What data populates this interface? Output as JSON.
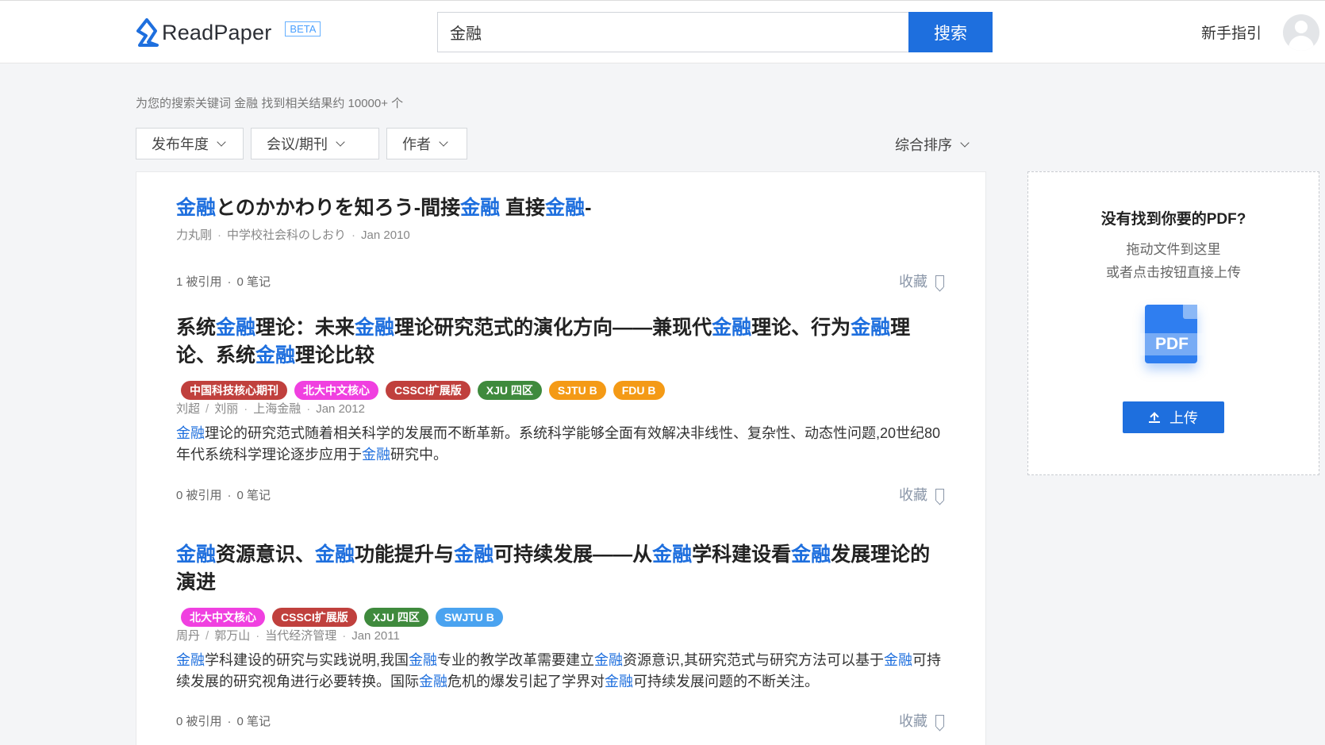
{
  "header": {
    "logo_text": "ReadPaper",
    "beta_label": "BETA",
    "search_value": "金融",
    "search_button": "搜索",
    "guide_link": "新手指引"
  },
  "summary": "为您的搜索关键词 金融 找到相关结果约 10000+ 个",
  "filters": [
    {
      "label": "发布年度"
    },
    {
      "label": "会议/期刊"
    },
    {
      "label": "作者"
    }
  ],
  "sort_label": "综合排序",
  "results": [
    {
      "title": [
        {
          "t": "金融",
          "hl": true
        },
        {
          "t": "とのかかわりを知ろう-間接"
        },
        {
          "t": "金融",
          "hl": true
        },
        {
          "t": " 直接"
        },
        {
          "t": "金融",
          "hl": true
        },
        {
          "t": "-"
        }
      ],
      "authors": [
        "力丸剛"
      ],
      "venue": "中学校社会科のしおり",
      "date": "Jan 2010",
      "tags": [],
      "abstract": [],
      "citations": "1 被引用",
      "notes": "0 笔记",
      "collect": "收藏"
    },
    {
      "title": [
        {
          "t": "系统"
        },
        {
          "t": "金融",
          "hl": true
        },
        {
          "t": "理论：未来"
        },
        {
          "t": "金融",
          "hl": true
        },
        {
          "t": "理论研究范式的演化方向——兼现代"
        },
        {
          "t": "金融",
          "hl": true
        },
        {
          "t": "理论、行为"
        },
        {
          "t": "金融",
          "hl": true
        },
        {
          "t": "理论、系统"
        },
        {
          "t": "金融",
          "hl": true
        },
        {
          "t": "理论比较"
        }
      ],
      "authors": [
        "刘超",
        "刘丽"
      ],
      "venue": "上海金融",
      "date": "Jan 2012",
      "tags": [
        {
          "label": "中国科技核心期刊",
          "color": "#c0403d"
        },
        {
          "label": "北大中文核心",
          "color": "#f040e0"
        },
        {
          "label": "CSSCI扩展版",
          "color": "#c0403d"
        },
        {
          "label": "XJU 四区",
          "color": "#3f8a3d"
        },
        {
          "label": "SJTU B",
          "color": "#f49a16"
        },
        {
          "label": "FDU B",
          "color": "#f49a16"
        }
      ],
      "abstract": [
        {
          "t": "金融",
          "hl": true
        },
        {
          "t": "理论的研究范式随着相关科学的发展而不断革新。系统科学能够全面有效解决非线性、复杂性、动态性问题,20世纪80年代系统科学理论逐步应用于"
        },
        {
          "t": "金融",
          "hl": true
        },
        {
          "t": "研究中。"
        }
      ],
      "citations": "0 被引用",
      "notes": "0 笔记",
      "collect": "收藏"
    },
    {
      "title": [
        {
          "t": "金融",
          "hl": true
        },
        {
          "t": "资源意识、"
        },
        {
          "t": "金融",
          "hl": true
        },
        {
          "t": "功能提升与"
        },
        {
          "t": "金融",
          "hl": true
        },
        {
          "t": "可持续发展——从"
        },
        {
          "t": "金融",
          "hl": true
        },
        {
          "t": "学科建设看"
        },
        {
          "t": "金融",
          "hl": true
        },
        {
          "t": "发展理论的演进"
        }
      ],
      "authors": [
        "周丹",
        "郭万山"
      ],
      "venue": "当代经济管理",
      "date": "Jan 2011",
      "tags": [
        {
          "label": "北大中文核心",
          "color": "#f040e0"
        },
        {
          "label": "CSSCI扩展版",
          "color": "#c0403d"
        },
        {
          "label": "XJU 四区",
          "color": "#3f8a3d"
        },
        {
          "label": "SWJTU B",
          "color": "#4aa3f0"
        }
      ],
      "abstract": [
        {
          "t": "金融",
          "hl": true
        },
        {
          "t": "学科建设的研究与实践说明,我国"
        },
        {
          "t": "金融",
          "hl": true
        },
        {
          "t": "专业的教学改革需要建立"
        },
        {
          "t": "金融",
          "hl": true
        },
        {
          "t": "资源意识,其研究范式与研究方法可以基于"
        },
        {
          "t": "金融",
          "hl": true
        },
        {
          "t": "可持续发展的研究视角进行必要转换。国际"
        },
        {
          "t": "金融",
          "hl": true
        },
        {
          "t": "危机的爆发引起了学界对"
        },
        {
          "t": "金融",
          "hl": true
        },
        {
          "t": "可持续发展问题的不断关注。"
        }
      ],
      "citations": "0 被引用",
      "notes": "0 笔记",
      "collect": "收藏"
    }
  ],
  "upload": {
    "title": "没有找到你要的PDF?",
    "line1": "拖动文件到这里",
    "line2": "或者点击按钮直接上传",
    "icon_label": "PDF",
    "button": "上传"
  },
  "colors": {
    "accent": "#1e6fde",
    "highlight": "#1e6fde"
  }
}
